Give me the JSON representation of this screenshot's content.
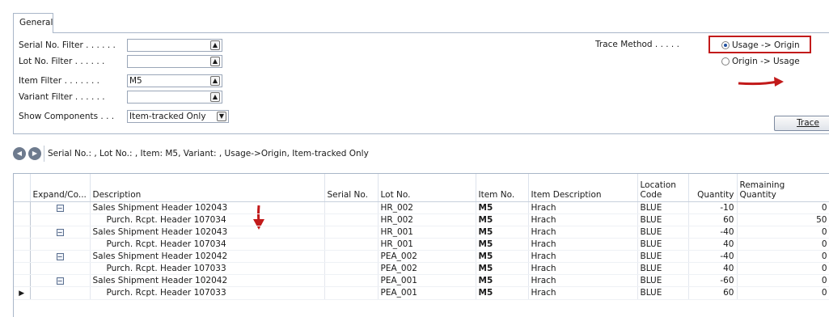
{
  "tab": {
    "label": "General"
  },
  "filters": {
    "serial_no": {
      "label": "Serial No. Filter . . . . . .",
      "value": ""
    },
    "lot_no": {
      "label": "Lot No. Filter . . . . . .",
      "value": ""
    },
    "item": {
      "label": "Item Filter . . . . . . .",
      "value": "M5"
    },
    "variant": {
      "label": "Variant Filter . . . . . .",
      "value": ""
    },
    "show_components": {
      "label": "Show Components . . .",
      "value": "Item-tracked Only"
    }
  },
  "trace_method": {
    "label": "Trace Method . . . . .",
    "options": [
      "Usage -> Origin",
      "Origin -> Usage"
    ],
    "selected": "Usage -> Origin"
  },
  "trace_button": {
    "label": "Trace"
  },
  "nav_summary": "Serial No.: , Lot No.: , Item: M5, Variant: , Usage->Origin, Item-tracked Only",
  "grid": {
    "columns": {
      "expand": "Expand/Co...",
      "description": "Description",
      "serial_no": "Serial No.",
      "lot_no": "Lot No.",
      "item_no": "Item No.",
      "item_description": "Item Description",
      "location_1": "Location",
      "location_2": "Code",
      "quantity": "Quantity",
      "remaining_1": "Remaining",
      "remaining_2": "Quantity"
    },
    "rows": [
      {
        "description": "Sales Shipment Header 102043",
        "lot": "HR_002",
        "item": "M5",
        "item_desc": "Hrach",
        "loc": "BLUE",
        "qty": "-10",
        "rem": "0"
      },
      {
        "description": "Purch. Rcpt. Header 107034",
        "lot": "HR_002",
        "item": "M5",
        "item_desc": "Hrach",
        "loc": "BLUE",
        "qty": "60",
        "rem": "50"
      },
      {
        "description": "Sales Shipment Header 102043",
        "lot": "HR_001",
        "item": "M5",
        "item_desc": "Hrach",
        "loc": "BLUE",
        "qty": "-40",
        "rem": "0"
      },
      {
        "description": "Purch. Rcpt. Header 107034",
        "lot": "HR_001",
        "item": "M5",
        "item_desc": "Hrach",
        "loc": "BLUE",
        "qty": "40",
        "rem": "0"
      },
      {
        "description": "Sales Shipment Header 102042",
        "lot": "PEA_002",
        "item": "M5",
        "item_desc": "Hrach",
        "loc": "BLUE",
        "qty": "-40",
        "rem": "0"
      },
      {
        "description": "Purch. Rcpt. Header 107033",
        "lot": "PEA_002",
        "item": "M5",
        "item_desc": "Hrach",
        "loc": "BLUE",
        "qty": "40",
        "rem": "0"
      },
      {
        "description": "Sales Shipment Header 102042",
        "lot": "PEA_001",
        "item": "M5",
        "item_desc": "Hrach",
        "loc": "BLUE",
        "qty": "-60",
        "rem": "0"
      },
      {
        "description": "Purch. Rcpt. Header 107033",
        "lot": "PEA_001",
        "item": "M5",
        "item_desc": "Hrach",
        "loc": "BLUE",
        "qty": "60",
        "rem": "0"
      }
    ]
  },
  "colors": {
    "accent_red": "#c21a1a",
    "border": "#a9b6c8"
  }
}
